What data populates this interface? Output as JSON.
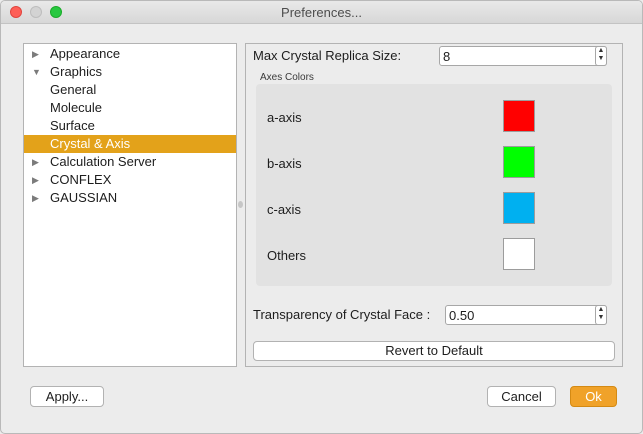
{
  "window": {
    "title": "Preferences..."
  },
  "tree": {
    "items": [
      {
        "label": "Appearance",
        "arrow": "▶"
      },
      {
        "label": "Graphics",
        "arrow": "▼"
      },
      {
        "label": "General",
        "arrow": ""
      },
      {
        "label": "Molecule",
        "arrow": ""
      },
      {
        "label": "Surface",
        "arrow": ""
      },
      {
        "label": "Crystal & Axis",
        "arrow": "",
        "selected": true
      },
      {
        "label": "Calculation Server",
        "arrow": "▶"
      },
      {
        "label": "CONFLEX",
        "arrow": "▶"
      },
      {
        "label": "GAUSSIAN",
        "arrow": "▶"
      }
    ]
  },
  "panel": {
    "replica": {
      "label": "Max Crystal Replica Size:",
      "value": "8"
    },
    "axes": {
      "title": "Axes Colors",
      "items": [
        {
          "label": "a-axis",
          "color": "#ff0000"
        },
        {
          "label": "b-axis",
          "color": "#00ff00"
        },
        {
          "label": "c-axis",
          "color": "#00b0f0"
        },
        {
          "label": "Others",
          "color": "#ffffff"
        }
      ]
    },
    "transparency": {
      "label": "Transparency of Crystal Face :",
      "value": "0.50"
    },
    "revert_label": "Revert to Default"
  },
  "footer": {
    "apply": "Apply...",
    "cancel": "Cancel",
    "ok": "Ok"
  },
  "stepper": {
    "up": "▲",
    "down": "▼"
  }
}
